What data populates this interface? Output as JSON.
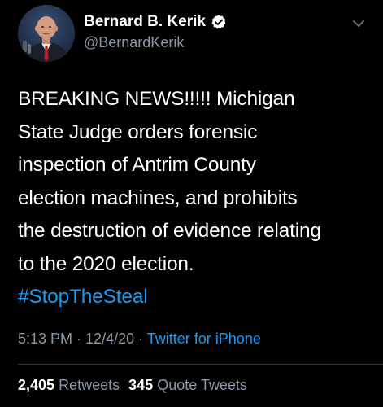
{
  "author": {
    "display_name": "Bernard B. Kerik",
    "handle": "@BernardKerik",
    "verified": true,
    "avatar_icon": "profile-photo"
  },
  "tweet": {
    "lines": [
      "BREAKING NEWS!!!!! Michigan",
      "State Judge orders forensic",
      "inspection of Antrim County",
      "election machines, and prohibits",
      "the destruction of evidence relating",
      "to the 2020 election."
    ],
    "hashtag": "#StopTheSteal"
  },
  "meta": {
    "time": "5:13 PM",
    "separator_1": " · ",
    "date": "12/4/20",
    "separator_2": " · ",
    "source": "Twitter for iPhone"
  },
  "stats": {
    "retweets_count": "2,405",
    "retweets_label": "Retweets",
    "quotes_count": "345",
    "quotes_label": "Quote Tweets"
  },
  "colors": {
    "background": "#000000",
    "text": "#ffffff",
    "muted": "#8b98a5",
    "accent": "#1d9bf0"
  }
}
